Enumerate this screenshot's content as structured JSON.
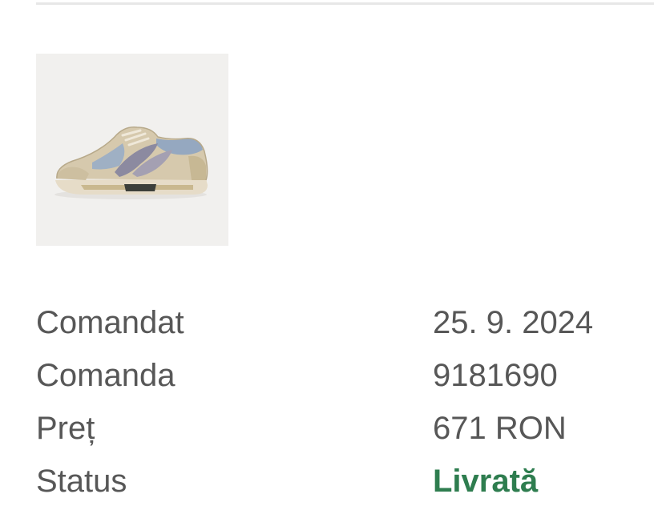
{
  "order": {
    "product_image_icon": "sneaker-image",
    "details": [
      {
        "label": "Comandat",
        "value": "25. 9. 2024"
      },
      {
        "label": "Comanda",
        "value": "9181690"
      },
      {
        "label": "Preț",
        "value": "671 RON"
      },
      {
        "label": "Status",
        "value": "Livrată"
      }
    ],
    "status_color": "#2e7d4f"
  }
}
